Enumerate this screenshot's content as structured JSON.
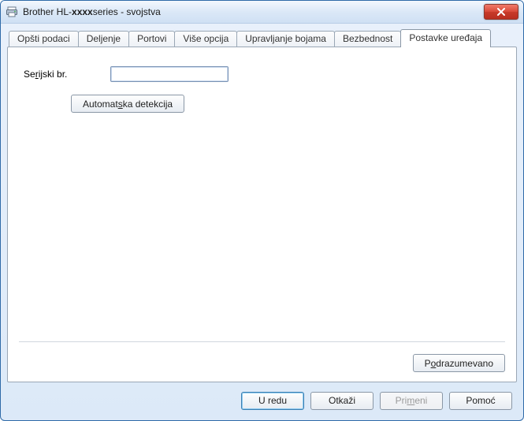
{
  "window": {
    "title_prefix": "Brother HL-",
    "title_bold": "xxxx",
    "title_suffix": "series - svojstva"
  },
  "tabs": [
    {
      "label": "Opšti podaci",
      "active": false
    },
    {
      "label": "Deljenje",
      "active": false
    },
    {
      "label": "Portovi",
      "active": false
    },
    {
      "label": "Više opcija",
      "active": false
    },
    {
      "label": "Upravljanje bojama",
      "active": false
    },
    {
      "label": "Bezbednost",
      "active": false
    },
    {
      "label": "Postavke uređaja",
      "active": true
    }
  ],
  "form": {
    "serial_label_pre": "Se",
    "serial_label_key": "r",
    "serial_label_post": "ijski br.",
    "serial_value": "",
    "auto_detect_pre": "Automat",
    "auto_detect_key": "s",
    "auto_detect_post": "ka detekcija",
    "defaults_pre": "P",
    "defaults_key": "o",
    "defaults_post": "drazumevano"
  },
  "buttons": {
    "ok": "U redu",
    "cancel": "Otkaži",
    "apply_pre": "Pri",
    "apply_key": "m",
    "apply_post": "eni",
    "apply_enabled": false,
    "help": "Pomoć"
  }
}
